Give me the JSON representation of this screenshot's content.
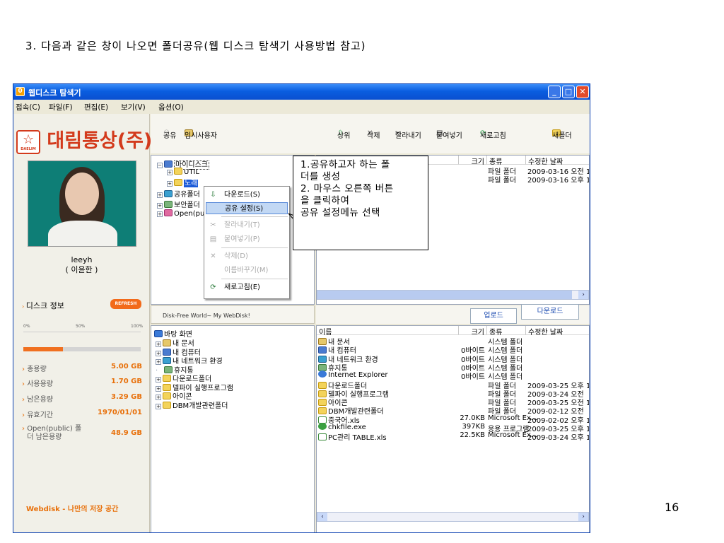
{
  "caption": "3. 다음과 같은 창이 나오면 폴더공유(웹 디스크 탐색기 사용방법 참고)",
  "page_number": "16",
  "window": {
    "title": "웹디스크 탐색기"
  },
  "menu": [
    "접속(C)",
    "파일(F)",
    "편집(E)",
    "보기(V)",
    "옵션(O)"
  ],
  "logo_text": "대림통상(주)",
  "logo_small": "DAELIM",
  "user": {
    "id": "leeyh",
    "name": "( 이윤한 )"
  },
  "disk": {
    "title": "디스크 정보",
    "refresh": "REFRESH",
    "scale": [
      "0%",
      "50%",
      "100%"
    ],
    "used_fraction": 0.34,
    "stats": [
      {
        "label": "총용량",
        "value": "5.00 GB"
      },
      {
        "label": "사용용량",
        "value": "1.70 GB"
      },
      {
        "label": "남은용량",
        "value": "3.29 GB"
      },
      {
        "label": "유효기간",
        "value": "1970/01/01"
      },
      {
        "label": "Open(public) 폴더 남은용량",
        "value": "48.9 GB"
      }
    ],
    "tagline": "Webdisk - 나만의 저장 공간"
  },
  "toolbar": {
    "share": "공유",
    "temp_user": "임시사용자",
    "up": "상위",
    "delete": "삭제",
    "cut": "잘라내기",
    "paste": "붙여넣기",
    "refresh": "새로고침",
    "new_folder": "새폴더"
  },
  "top_tree": {
    "root": "마이디스크",
    "items": [
      "UTIL",
      "노래",
      "공유폴더",
      "보안폴더",
      "Open(public)"
    ]
  },
  "columns": {
    "name": "이름",
    "size": "크기",
    "type": "종류",
    "date": "수정한 날짜"
  },
  "top_files": [
    {
      "name": "UTIL",
      "size": "",
      "type": "파일 폴더",
      "date": "2009-03-16 오전 1"
    },
    {
      "name": "노래",
      "size": "",
      "type": "파일 폴더",
      "date": "2009-03-16 오후 1"
    }
  ],
  "context_menu": [
    {
      "label": "다운로드(S)",
      "icon": "download-icon",
      "state": "normal"
    },
    {
      "label": "공유 설정(S)",
      "icon": "",
      "state": "selected"
    },
    {
      "label": "잘라내기(T)",
      "icon": "scissors-icon",
      "state": "disabled"
    },
    {
      "label": "붙여넣기(P)",
      "icon": "paste-icon",
      "state": "disabled"
    },
    {
      "label": "삭제(D)",
      "icon": "delete-icon",
      "state": "disabled"
    },
    {
      "label": "이름바꾸기(M)",
      "icon": "",
      "state": "disabled"
    },
    {
      "label": "새로고침(E)",
      "icon": "refresh-icon",
      "state": "normal"
    }
  ],
  "callout_lines": [
    "1.공유하고자 하는 폴",
    "더를 생성",
    "2. 마우스 오른쪽 버튼",
    "을 클릭하여",
    "공유 설정메뉴 선택"
  ],
  "status_left": "Disk-Free World~ My WebDisk!",
  "upload": "업로드",
  "download": "다운로드",
  "bottom_tree": {
    "root": "바탕 화면",
    "items": [
      "내 문서",
      "내 컴퓨터",
      "내 네트워크 환경",
      "휴지통",
      "다운로드폴더",
      "델파이 실행프로그램",
      "아이콘",
      "DBM개발관련폴더"
    ]
  },
  "bottom_files": [
    {
      "name": "내 문서",
      "size": "",
      "type": "시스템 폴더",
      "date": "",
      "icon": "sys"
    },
    {
      "name": "내 컴퓨터",
      "size": "0바이트",
      "type": "시스템 폴더",
      "date": "",
      "icon": "pc"
    },
    {
      "name": "내 네트워크 환경",
      "size": "0바이트",
      "type": "시스템 폴더",
      "date": "",
      "icon": "net"
    },
    {
      "name": "휴지통",
      "size": "0바이트",
      "type": "시스템 폴더",
      "date": "",
      "icon": "bin"
    },
    {
      "name": "Internet Explorer",
      "size": "0바이트",
      "type": "시스템 폴더",
      "date": "",
      "icon": "ie"
    },
    {
      "name": "다운로드폴더",
      "size": "",
      "type": "파일 폴더",
      "date": "2009-03-25 오후 1",
      "icon": "folder"
    },
    {
      "name": "델파이 실행프로그램",
      "size": "",
      "type": "파일 폴더",
      "date": "2009-03-24 오전",
      "icon": "folder"
    },
    {
      "name": "아이콘",
      "size": "",
      "type": "파일 폴더",
      "date": "2009-03-25 오전 1",
      "icon": "folder"
    },
    {
      "name": "DBM개발관련폴더",
      "size": "",
      "type": "파일 폴더",
      "date": "2009-02-12 오전",
      "icon": "folder"
    },
    {
      "name": "중국어.xls",
      "size": "27.0KB",
      "type": "Microsoft Ex...",
      "date": "2009-02-02 오후 1",
      "icon": "xls"
    },
    {
      "name": "chkfile.exe",
      "size": "397KB",
      "type": "응용 프로그램",
      "date": "2009-03-25 오후 1",
      "icon": "exe"
    },
    {
      "name": "PC관리 TABLE.xls",
      "size": "22.5KB",
      "type": "Microsoft Ex...",
      "date": "2009-03-24 오후 1",
      "icon": "xls"
    }
  ]
}
